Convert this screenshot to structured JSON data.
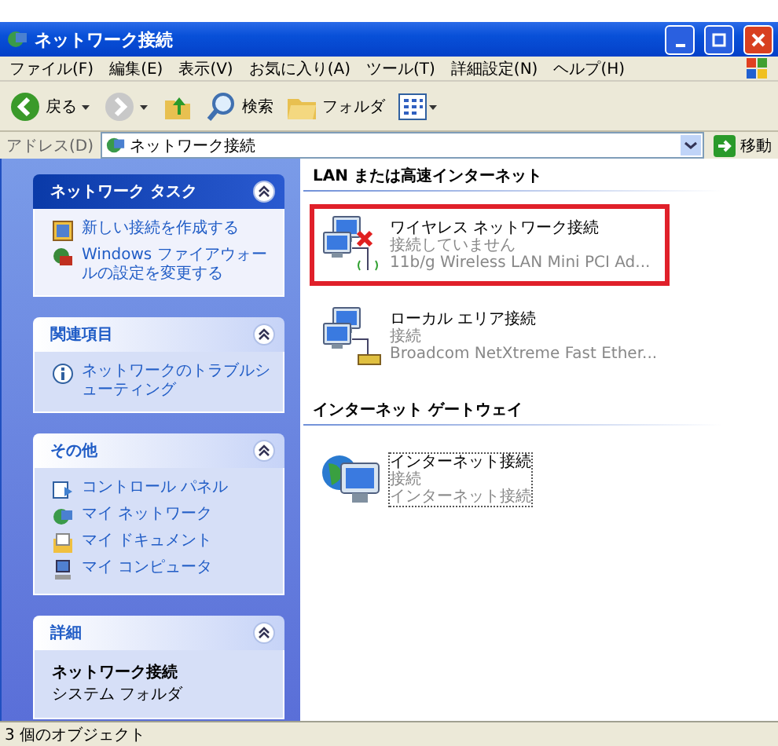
{
  "window": {
    "title": "ネットワーク接続"
  },
  "menu": [
    "ファイル(F)",
    "編集(E)",
    "表示(V)",
    "お気に入り(A)",
    "ツール(T)",
    "詳細設定(N)",
    "ヘルプ(H)"
  ],
  "toolbar": [
    {
      "kind": "back",
      "label": "戻る"
    },
    {
      "kind": "forward"
    },
    {
      "kind": "up"
    },
    {
      "kind": "search",
      "label": "検索"
    },
    {
      "kind": "folders",
      "label": "フォルダ"
    },
    {
      "kind": "views"
    }
  ],
  "address": {
    "label": "アドレス(D)",
    "value": "ネットワーク接続",
    "go": "移動"
  },
  "sidebar": [
    {
      "title": "ネットワーク タスク",
      "kind": "tasks",
      "items": [
        {
          "kind": "new",
          "label": "新しい接続を作成する"
        },
        {
          "kind": "firewall",
          "label": "Windows ファイアウォールの設定を変更する"
        }
      ]
    },
    {
      "title": "関連項目",
      "kind": "links",
      "items": [
        {
          "kind": "info",
          "label": "ネットワークのトラブルシューティング"
        }
      ]
    },
    {
      "title": "その他",
      "kind": "links",
      "items": [
        {
          "kind": "panel",
          "label": "コントロール パネル"
        },
        {
          "kind": "network",
          "label": "マイ ネットワーク"
        },
        {
          "kind": "docs",
          "label": "マイ ドキュメント"
        },
        {
          "kind": "computer",
          "label": "マイ コンピュータ"
        }
      ]
    },
    {
      "title": "詳細",
      "kind": "details",
      "name": "ネットワーク接続",
      "sub": "システム フォルダ"
    }
  ],
  "sections": [
    {
      "title": "LAN または高速インターネット",
      "items": [
        {
          "kind": "wireless",
          "name": "ワイヤレス ネットワーク接続",
          "status": "接続していません",
          "device": "11b/g Wireless LAN Mini PCI Ad...",
          "highlighted": true,
          "focused": false
        },
        {
          "kind": "lan",
          "name": "ローカル エリア接続",
          "status": "接続",
          "device": "Broadcom NetXtreme Fast Ether...",
          "highlighted": false,
          "focused": false
        }
      ]
    },
    {
      "title": "インターネット ゲートウェイ",
      "items": [
        {
          "kind": "gateway",
          "name": "インターネット接続",
          "status": "接続",
          "device": "インターネット接続",
          "highlighted": false,
          "focused": true
        }
      ]
    }
  ],
  "status_bar": "3 個のオブジェクト"
}
